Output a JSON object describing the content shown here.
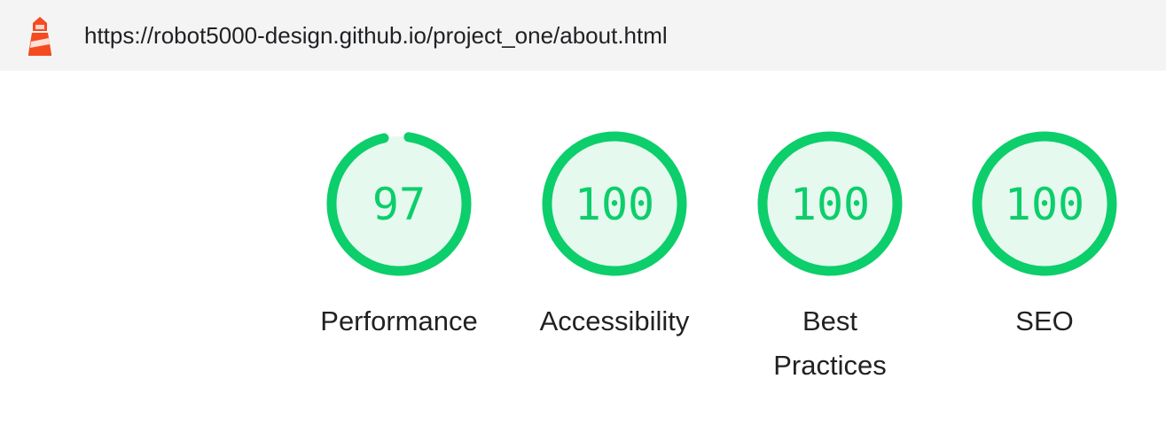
{
  "header": {
    "url": "https://robot5000-design.github.io/project_one/about.html",
    "logo_icon": "lighthouse-icon"
  },
  "colors": {
    "pass_stroke": "#0cce6b",
    "pass_fill": "#e6f9ee",
    "pass_text": "#0cce6b",
    "logo_red": "#f44b21",
    "topbar_bg": "#f4f4f4"
  },
  "gauges": [
    {
      "id": "performance",
      "score": "97",
      "value": 97,
      "label": "Performance"
    },
    {
      "id": "accessibility",
      "score": "100",
      "value": 100,
      "label": "Accessibility"
    },
    {
      "id": "best-practices",
      "score": "100",
      "value": 100,
      "label": "Best Practices"
    },
    {
      "id": "seo",
      "score": "100",
      "value": 100,
      "label": "SEO"
    }
  ]
}
